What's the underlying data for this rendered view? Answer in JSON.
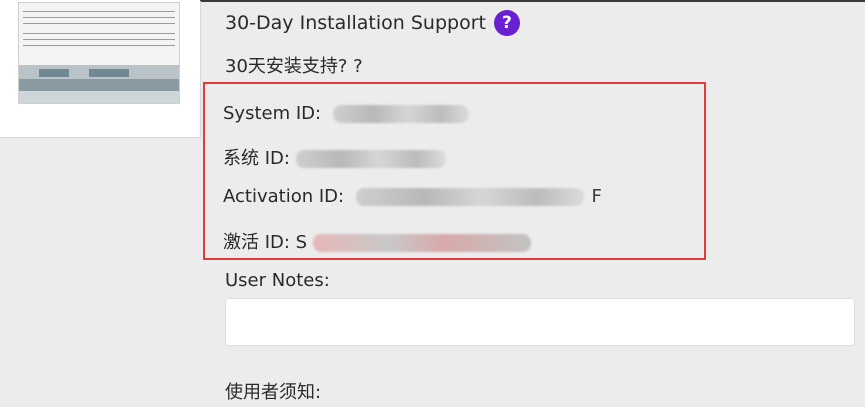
{
  "header": {
    "title": "30-Day Installation Support",
    "help_glyph": "?",
    "subtitle": "30天安装支持? ?"
  },
  "ids": {
    "system_label": "System ID:",
    "system_label_cn": "系统 ID:",
    "activation_label": "Activation ID:",
    "activation_tail": "F",
    "activation_label_cn": "激活 ID: S"
  },
  "notes": {
    "label": "User Notes:",
    "value": "",
    "label_cn": "使用者须知:"
  },
  "colors": {
    "accent": "#6a1fd0",
    "highlight_border": "#e23b3b",
    "background": "#ececec"
  }
}
